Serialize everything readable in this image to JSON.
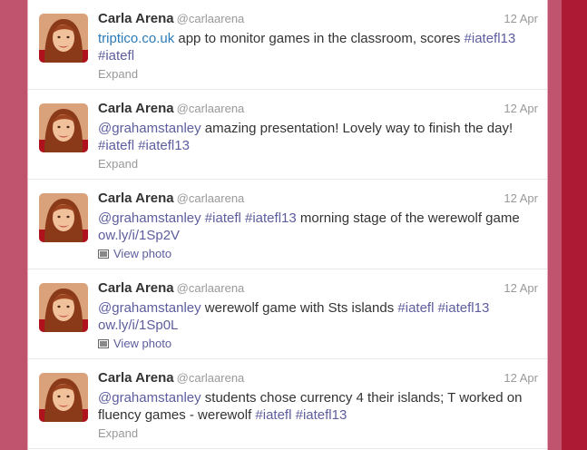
{
  "tweets": [
    {
      "fullname": "Carla Arena",
      "username": "@carlaarena",
      "time": "12 Apr",
      "parts": [
        {
          "t": "triptico.co.uk",
          "k": "link"
        },
        {
          "t": " app to monitor games in the classroom, scores ",
          "k": "text"
        },
        {
          "t": "#iatefl13",
          "k": "hashtag"
        },
        {
          "t": " ",
          "k": "text"
        },
        {
          "t": "#iatefl",
          "k": "hashtag"
        }
      ],
      "action": "Expand",
      "action_type": "expand"
    },
    {
      "fullname": "Carla Arena",
      "username": "@carlaarena",
      "time": "12 Apr",
      "parts": [
        {
          "t": "@grahamstanley",
          "k": "mention"
        },
        {
          "t": " amazing presentation! Lovely way to finish the day! ",
          "k": "text"
        },
        {
          "t": "#iatefl",
          "k": "hashtag"
        },
        {
          "t": " ",
          "k": "text"
        },
        {
          "t": "#iatefl13",
          "k": "hashtag"
        }
      ],
      "action": "Expand",
      "action_type": "expand"
    },
    {
      "fullname": "Carla Arena",
      "username": "@carlaarena",
      "time": "12 Apr",
      "parts": [
        {
          "t": "@grahamstanley",
          "k": "mention"
        },
        {
          "t": " ",
          "k": "text"
        },
        {
          "t": "#iatefl",
          "k": "hashtag"
        },
        {
          "t": " ",
          "k": "text"
        },
        {
          "t": "#iatefl13",
          "k": "hashtag"
        },
        {
          "t": " morning stage of the werewolf game ",
          "k": "text"
        },
        {
          "t": "ow.ly/i/1Sp2V",
          "k": "hashtag"
        }
      ],
      "action": "View photo",
      "action_type": "photo"
    },
    {
      "fullname": "Carla Arena",
      "username": "@carlaarena",
      "time": "12 Apr",
      "parts": [
        {
          "t": "@grahamstanley",
          "k": "mention"
        },
        {
          "t": " werewolf game with Sts islands ",
          "k": "text"
        },
        {
          "t": "#iatefl",
          "k": "hashtag"
        },
        {
          "t": " ",
          "k": "text"
        },
        {
          "t": "#iatefl13",
          "k": "hashtag"
        },
        {
          "t": " ",
          "k": "text"
        },
        {
          "t": "ow.ly/i/1Sp0L",
          "k": "hashtag"
        }
      ],
      "action": "View photo",
      "action_type": "photo"
    },
    {
      "fullname": "Carla Arena",
      "username": "@carlaarena",
      "time": "12 Apr",
      "parts": [
        {
          "t": "@grahamstanley",
          "k": "mention"
        },
        {
          "t": " students chose currency 4 their islands; T worked on fluency games - werewolf ",
          "k": "text"
        },
        {
          "t": "#iatefl",
          "k": "hashtag"
        },
        {
          "t": " ",
          "k": "text"
        },
        {
          "t": "#iatefl13",
          "k": "hashtag"
        }
      ],
      "action": "Expand",
      "action_type": "expand"
    }
  ],
  "colors": {
    "background": "#c0546f",
    "accent_strip": "#ad1a33",
    "link": "#2b7bb9",
    "hashtag": "#5d5d9e",
    "muted": "#999999"
  },
  "icons": {
    "avatar": "avatar-photo",
    "photo": "photo-icon"
  }
}
